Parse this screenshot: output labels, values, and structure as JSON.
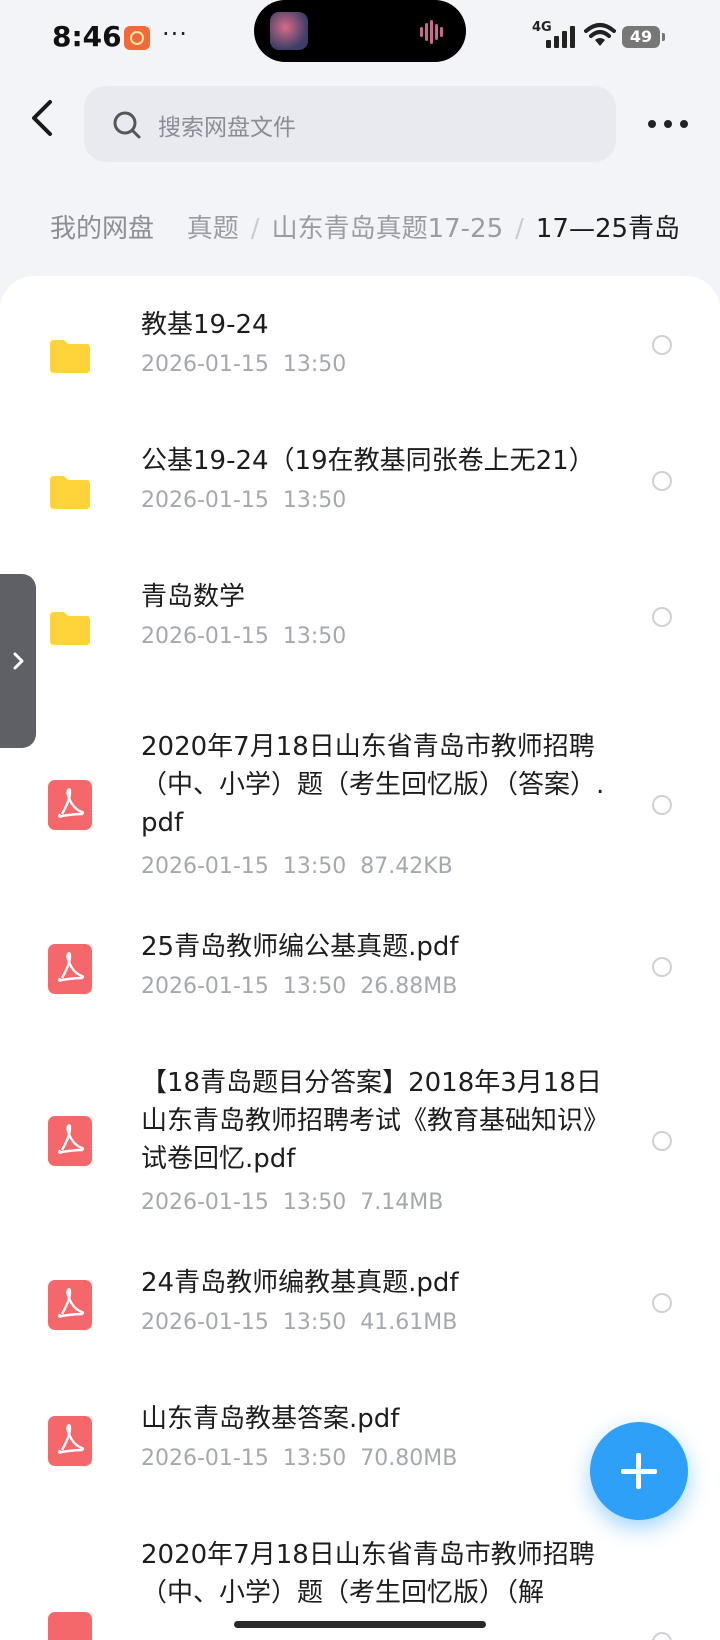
{
  "status_bar": {
    "time": "8:46",
    "dots": "···",
    "network": "4G",
    "battery": "49"
  },
  "header": {
    "search_placeholder": "搜索网盘文件"
  },
  "breadcrumb": [
    "我的网盘",
    "真题",
    "山东青岛真题17-25",
    "17—25青岛"
  ],
  "breadcrumb_separator": "/",
  "files": [
    {
      "type": "folder",
      "name": "教基19-24",
      "date": "2026-01-15",
      "time": "13:50",
      "size": ""
    },
    {
      "type": "folder",
      "name": "公基19-24（19在教基同张卷上无21）",
      "date": "2026-01-15",
      "time": "13:50",
      "size": ""
    },
    {
      "type": "folder",
      "name": "青岛数学",
      "date": "2026-01-15",
      "time": "13:50",
      "size": ""
    },
    {
      "type": "pdf",
      "name": "2020年7月18日山东省青岛市教师招聘（中、小学）题（考生回忆版）（答案）.pdf",
      "date": "2026-01-15",
      "time": "13:50",
      "size": "87.42KB"
    },
    {
      "type": "pdf",
      "name": "25青岛教师编公基真题.pdf",
      "date": "2026-01-15",
      "time": "13:50",
      "size": "26.88MB"
    },
    {
      "type": "pdf",
      "name": "【18青岛题目分答案】2018年3月18日山东青岛教师招聘考试《教育基础知识》试卷回忆.pdf",
      "date": "2026-01-15",
      "time": "13:50",
      "size": "7.14MB"
    },
    {
      "type": "pdf",
      "name": "24青岛教师编教基真题.pdf",
      "date": "2026-01-15",
      "time": "13:50",
      "size": "41.61MB"
    },
    {
      "type": "pdf",
      "name": "山东青岛教基答案.pdf",
      "date": "2026-01-15",
      "time": "13:50",
      "size": "70.80MB"
    },
    {
      "type": "pdf",
      "name": "2020年7月18日山东省青岛市教师招聘（中、小学）题（考生回忆版）（解",
      "date": "",
      "time": "",
      "size": ""
    }
  ],
  "colors": {
    "folder": "#ffd43b",
    "pdf": "#f4676a",
    "fab": "#2fa0f8"
  }
}
